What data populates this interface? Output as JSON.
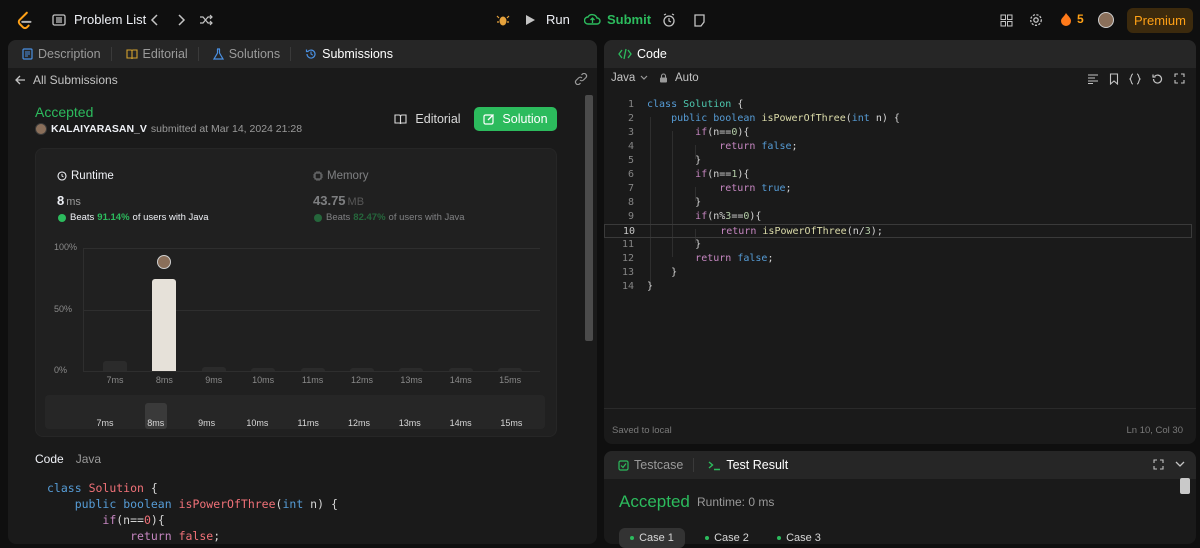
{
  "topbar": {
    "problem_list": "Problem List",
    "run": "Run",
    "submit": "Submit",
    "streak": "5",
    "premium": "Premium"
  },
  "left_tabs": {
    "description": "Description",
    "editorial": "Editorial",
    "solutions": "Solutions",
    "submissions": "Submissions"
  },
  "submission": {
    "back_link": "All Submissions",
    "status": "Accepted",
    "user": "KALAIYARASAN_V",
    "submitted_text": "submitted at Mar 14, 2024 21:28",
    "editorial_button": "Editorial",
    "solution_button": "Solution",
    "runtime_label": "Runtime",
    "runtime_value": "8",
    "runtime_unit": "ms",
    "runtime_beats_prefix": "Beats",
    "runtime_beats_pct": "91.14%",
    "runtime_beats_suffix": "of users with Java",
    "memory_label": "Memory",
    "memory_value": "43.75",
    "memory_unit": "MB",
    "memory_beats_prefix": "Beats",
    "memory_beats_pct": "82.47%",
    "memory_beats_suffix": "of users with Java",
    "code_label": "Code",
    "language": "Java"
  },
  "chart_data": {
    "type": "bar",
    "categories": [
      "7ms",
      "8ms",
      "9ms",
      "10ms",
      "11ms",
      "12ms",
      "13ms",
      "14ms",
      "15ms"
    ],
    "values": [
      8,
      75,
      3,
      2,
      2,
      2,
      2,
      2,
      2
    ],
    "highlight_index": 1,
    "yticks": [
      "100%",
      "50%",
      "0%"
    ],
    "ylim": [
      0,
      100
    ],
    "grid": true
  },
  "submitted_code": [
    "class Solution {",
    "    public boolean isPowerOfThree(int n) {",
    "        if(n==0){",
    "            return false;"
  ],
  "right_code": {
    "tab": "Code",
    "language": "Java",
    "mode": "Auto",
    "saved": "Saved to local",
    "cursor": "Ln 10, Col 30",
    "lines": [
      "class Solution {",
      "    public boolean isPowerOfThree(int n) {",
      "        if(n==0){",
      "            return false;",
      "        }",
      "        if(n==1){",
      "            return true;",
      "        }",
      "        if(n%3==0){",
      "            return isPowerOfThree(n/3);",
      "        }",
      "        return false;",
      "    }",
      "}"
    ]
  },
  "test_panel": {
    "testcase_tab": "Testcase",
    "result_tab": "Test Result",
    "status": "Accepted",
    "runtime": "Runtime: 0 ms",
    "cases": [
      "Case 1",
      "Case 2",
      "Case 3"
    ]
  },
  "colors": {
    "accent_green": "#2cbb5d",
    "premium_orange": "#ffa116",
    "panel_bg": "#1a1a1a",
    "page_bg": "#0f0f0f"
  }
}
